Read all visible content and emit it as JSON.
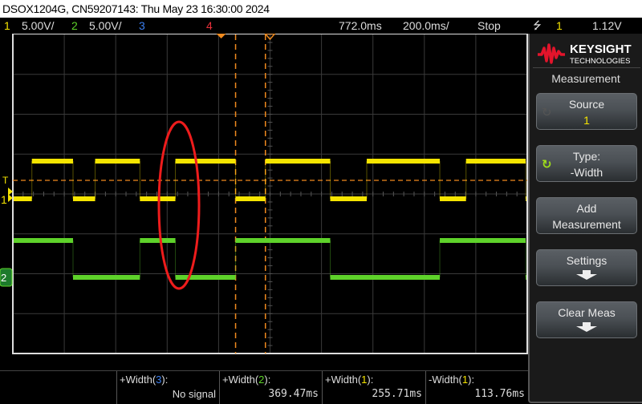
{
  "title_bar": "DSOX1204G, CN59207143: Thu May 23 16:30:00 2024",
  "channels": [
    {
      "num": "1",
      "scale": "5.00V/",
      "color": "#f5e400"
    },
    {
      "num": "2",
      "scale": "5.00V/",
      "color": "#5ed22a"
    },
    {
      "num": "3",
      "scale": "",
      "color": "#3b7ff0"
    },
    {
      "num": "4",
      "scale": "",
      "color": "#e8303a"
    }
  ],
  "timebase": {
    "delay": "772.0ms",
    "scale": "200.0ms/",
    "run_state": "Stop"
  },
  "trigger": {
    "slope_icon": "falling-edge",
    "source": "1",
    "level": "1.12V"
  },
  "panel": {
    "brand": "KEYSIGHT",
    "brand_sub": "TECHNOLOGIES",
    "title": "Measurement",
    "softkeys": [
      {
        "label": "Source",
        "sub": "1",
        "icon": "knob-inactive"
      },
      {
        "label": "Type:",
        "sub": "-Width",
        "icon": "knob-active"
      },
      {
        "label": "Add",
        "sub": "Measurement"
      },
      {
        "label": "Settings",
        "icon": "down-arrow"
      },
      {
        "label": "Clear Meas",
        "icon": "down-arrow"
      }
    ]
  },
  "measurements": [
    {
      "name": "+Width(",
      "src": "3",
      "src_color": "#3b7ff0",
      "suffix": "):",
      "value": "No signal"
    },
    {
      "name": "+Width(",
      "src": "2",
      "src_color": "#5ed22a",
      "suffix": "):",
      "value": "369.47ms"
    },
    {
      "name": "+Width(",
      "src": "1",
      "src_color": "#f5e400",
      "suffix": "):",
      "value": "255.71ms"
    },
    {
      "name": "-Width(",
      "src": "1",
      "src_color": "#f5e400",
      "suffix": "):",
      "value": "113.76ms"
    }
  ],
  "waveforms": {
    "ch1_edges_divs": [
      0.37,
      1.17,
      1.6,
      2.47,
      3.16,
      4.33,
      4.91,
      6.17,
      6.88,
      8.3,
      8.81,
      9.97
    ],
    "ch1_start_level": "low",
    "ch2_edges_divs": [
      1.17,
      2.47,
      3.16,
      4.33,
      6.17,
      8.3,
      9.97
    ],
    "ch2_start_level": "high"
  },
  "cursors_divs": [
    4.33,
    4.91
  ],
  "annotation": "red-ellipse-highlight"
}
